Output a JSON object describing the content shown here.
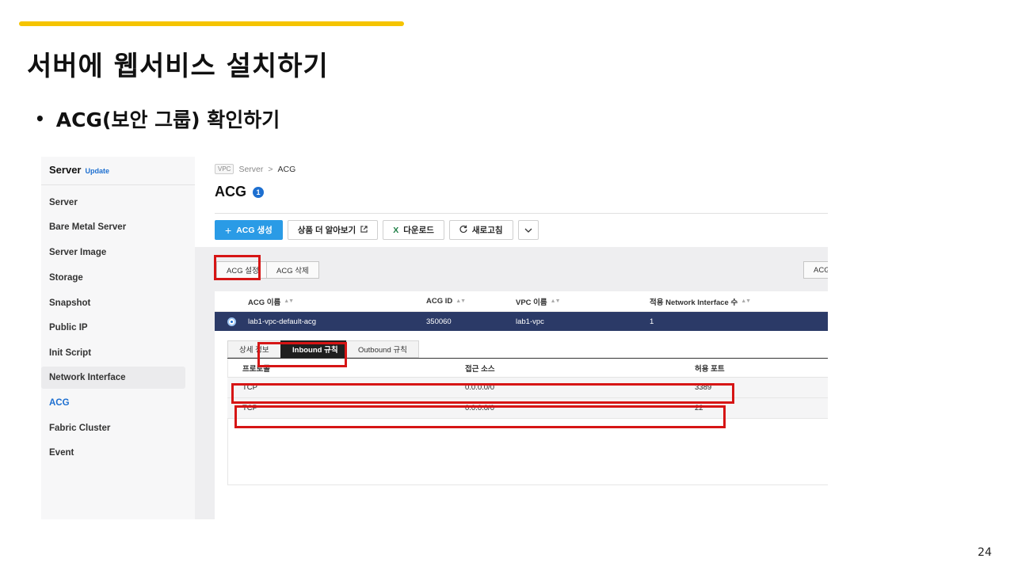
{
  "slide": {
    "title": "서버에 웹서비스 설치하기",
    "bullet": "ACG(보안 그룹) 확인하기",
    "page_number": "24"
  },
  "sidebar": {
    "title": "Server",
    "update_label": "Update",
    "items": [
      {
        "label": "Server"
      },
      {
        "label": "Bare Metal Server"
      },
      {
        "label": "Server Image"
      },
      {
        "label": "Storage"
      },
      {
        "label": "Snapshot"
      },
      {
        "label": "Public IP"
      },
      {
        "label": "Init Script"
      },
      {
        "label": "Network Interface"
      },
      {
        "label": "ACG"
      },
      {
        "label": "Fabric Cluster"
      },
      {
        "label": "Event"
      }
    ],
    "active_item": "ACG",
    "hover_item": "Network Interface"
  },
  "breadcrumb": {
    "badge": "VPC",
    "parent": "Server",
    "separator": ">",
    "current": "ACG"
  },
  "header": {
    "title": "ACG",
    "count": "1"
  },
  "toolbar": {
    "create_label": "ACG 생성",
    "learn_more_label": "상품 더 알아보기",
    "download_label": "다운로드",
    "refresh_label": "새로고침"
  },
  "actions": {
    "settings_label": "ACG 설정",
    "delete_label": "ACG 삭제",
    "right_label": "ACG"
  },
  "acg_table": {
    "columns": [
      "ACG 이름",
      "ACG ID",
      "VPC 이름",
      "적용 Network Interface 수"
    ],
    "rows": [
      {
        "name": "lab1-vpc-default-acg",
        "id": "350060",
        "vpc": "lab1-vpc",
        "nic_count": "1",
        "selected": true
      }
    ]
  },
  "detail_tabs": {
    "tabs": [
      "상세 정보",
      "Inbound 규칙",
      "Outbound 규칙"
    ],
    "active": "Inbound 규칙"
  },
  "inbound_table": {
    "columns": [
      "프로토콜",
      "접근 소스",
      "허용 포트"
    ],
    "rows": [
      {
        "protocol": "TCP",
        "source": "0.0.0.0/0",
        "port": "3389"
      },
      {
        "protocol": "TCP",
        "source": "0.0.0.0/0",
        "port": "22"
      }
    ]
  },
  "colors": {
    "accent_bar": "#f5c400",
    "primary_button": "#2a9be6",
    "selected_row": "#2b3a67",
    "highlight_box": "#d61515",
    "active_nav": "#1d6fd0"
  }
}
